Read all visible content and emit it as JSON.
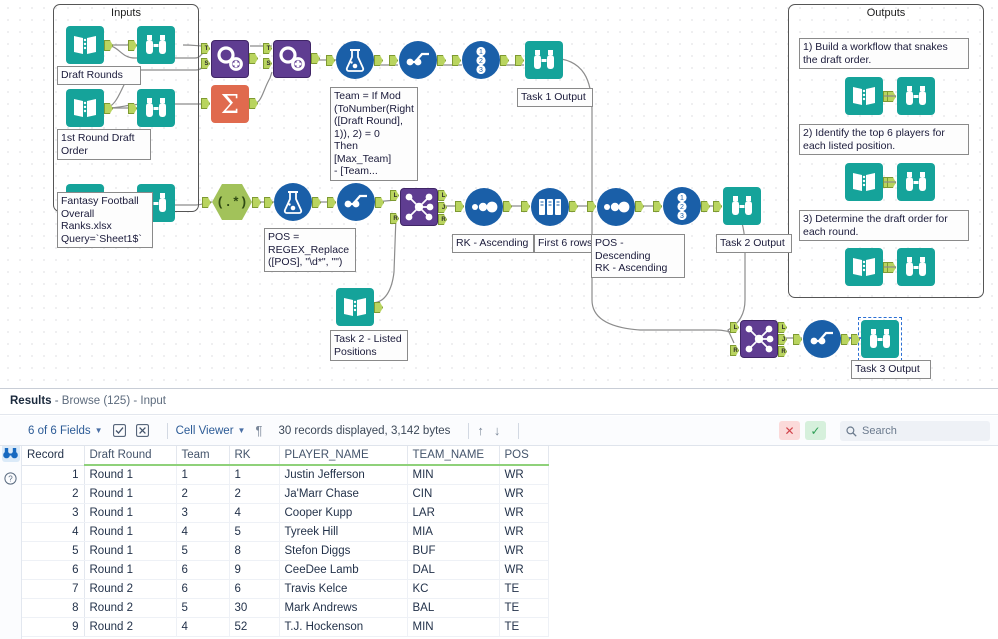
{
  "canvas": {
    "containers": [
      {
        "title": "Inputs"
      },
      {
        "title": "Outputs"
      }
    ],
    "input_labels": {
      "draft_rounds": "Draft Rounds",
      "first_round_draft_order": "1st Round Draft\nOrder",
      "fantasy_ranks": "Fantasy Football\nOverall\nRanks.xlsx\nQuery=`Sheet1$`"
    },
    "output_notes": [
      "1) Build a workflow that snakes the draft order.",
      "2) Identify the top 6 players for each listed position.",
      "3) Determine the draft order for each round."
    ],
    "annotations": {
      "formula_team": "Team = If Mod\n(ToNumber(Right\n([Draft Round],\n1)), 2) = 0\nThen [Max_Team]\n- [Team...",
      "formula_pos": "POS =\nREGEX_Replace\n([POS], \"\\d*\", \"\")",
      "task1_output": "Task 1 Output",
      "task2_output": "Task 2 Output",
      "task3_output": "Task 3 Output",
      "task2_listed_positions": "Task 2 - Listed\nPositions",
      "sort_rk_asc": "RK - Ascending",
      "sample_first6": "First 6 rows",
      "sort_pos_rk": "POS - Descending\nRK - Ascending"
    },
    "anchor_letters": {
      "t": "T",
      "s": "S",
      "l": "L",
      "j": "J",
      "r": "R"
    },
    "icon_names": {
      "input_data": "input-data-icon",
      "browse": "browse-binoculars-icon",
      "select": "select-gears-icon",
      "summarize": "summarize-sigma-icon",
      "regex": "regex-icon",
      "formula": "formula-flask-icon",
      "multi_row": "multirow-formula-icon",
      "record_id": "record-id-icon",
      "join": "join-icon",
      "sort": "sort-icon",
      "sample": "sample-icon"
    }
  },
  "results": {
    "header": {
      "title": "Results",
      "subtitle": "- Browse (125) - Input"
    },
    "toolbar": {
      "fields": "6 of 6 Fields",
      "cell_viewer": "Cell Viewer",
      "records": "30 records displayed, 3,142 bytes",
      "search_placeholder": "Search"
    },
    "table": {
      "columns": [
        "Record",
        "Draft Round",
        "Team",
        "RK",
        "PLAYER_NAME",
        "TEAM_NAME",
        "POS"
      ],
      "rows": [
        [
          "1",
          "Round 1",
          "1",
          "1",
          "Justin Jefferson",
          "MIN",
          "WR"
        ],
        [
          "2",
          "Round 1",
          "2",
          "2",
          "Ja'Marr Chase",
          "CIN",
          "WR"
        ],
        [
          "3",
          "Round 1",
          "3",
          "4",
          "Cooper Kupp",
          "LAR",
          "WR"
        ],
        [
          "4",
          "Round 1",
          "4",
          "5",
          "Tyreek Hill",
          "MIA",
          "WR"
        ],
        [
          "5",
          "Round 1",
          "5",
          "8",
          "Stefon Diggs",
          "BUF",
          "WR"
        ],
        [
          "6",
          "Round 1",
          "6",
          "9",
          "CeeDee Lamb",
          "DAL",
          "WR"
        ],
        [
          "7",
          "Round 2",
          "6",
          "6",
          "Travis Kelce",
          "KC",
          "TE"
        ],
        [
          "8",
          "Round 2",
          "5",
          "30",
          "Mark Andrews",
          "BAL",
          "TE"
        ],
        [
          "9",
          "Round 2",
          "4",
          "52",
          "T.J. Hockenson",
          "MIN",
          "TE"
        ]
      ]
    }
  },
  "colors": {
    "teal": "#15a39a",
    "purple": "#5f3d91",
    "orange": "#e06a4e",
    "blue": "#1a5fa8",
    "green_anchor": "#b9d45f",
    "header_underline": "#8fd17a",
    "accent_link": "#2c5b96"
  }
}
